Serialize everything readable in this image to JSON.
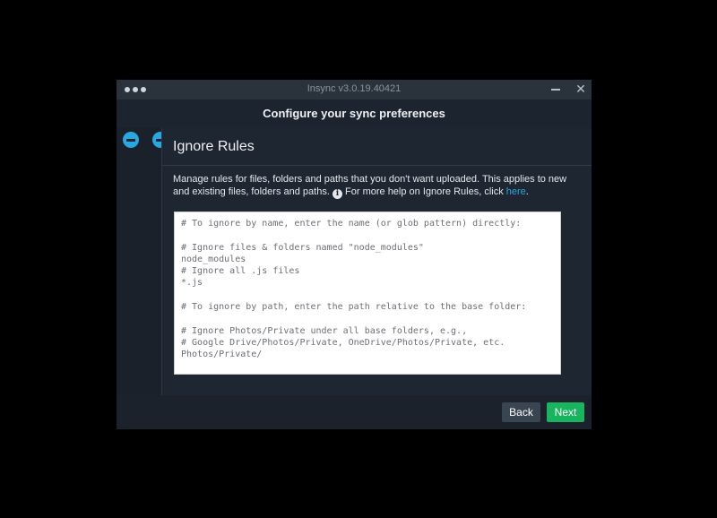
{
  "window": {
    "title": "Insync v3.0.19.40421",
    "header": "Configure your sync preferences"
  },
  "panel": {
    "title": "Ignore Rules",
    "description_part1": "Manage rules for files, folders and paths that you don't want uploaded. This applies to new and existing files, folders and paths.",
    "description_part2": "For more help on Ignore Rules, click",
    "link_text": "here",
    "description_end": "."
  },
  "editor": {
    "content": "# To ignore by name, enter the name (or glob pattern) directly:\n\n# Ignore files & folders named \"node_modules\"\nnode_modules\n# Ignore all .js files\n*.js\n\n# To ignore by path, enter the path relative to the base folder:\n\n# Ignore Photos/Private under all base folders, e.g.,\n# Google Drive/Photos/Private, OneDrive/Photos/Private, etc.\nPhotos/Private/"
  },
  "footer": {
    "back_label": "Back",
    "next_label": "Next"
  },
  "icons": {
    "menu": "menu-dots-icon",
    "minimize": "minimize-icon",
    "close": "close-icon",
    "step": "step-indicator-icon",
    "info": "info-icon"
  },
  "colors": {
    "accent": "#29a7e1",
    "next_button": "#18b45f",
    "back_button": "#3a4552",
    "window_bg": "#1c2430"
  }
}
